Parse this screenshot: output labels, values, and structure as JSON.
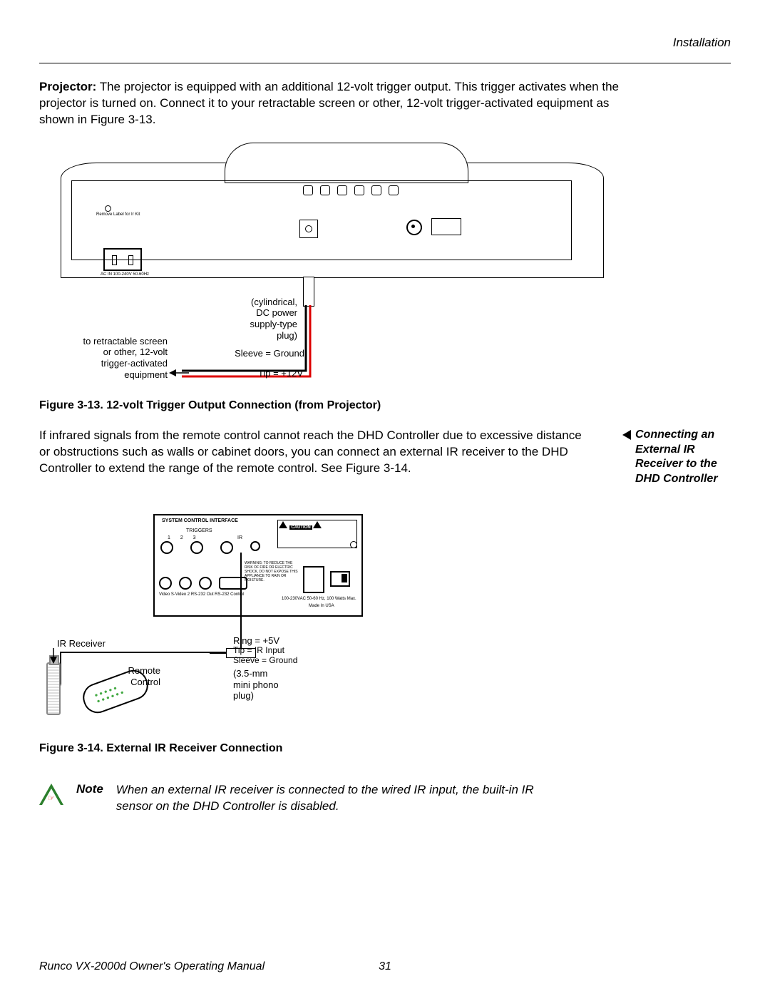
{
  "header": {
    "section": "Installation"
  },
  "para1": {
    "lead": "Projector:",
    "text": " The projector is equipped with an additional 12-volt trigger output. This trigger activates when the projector is turned on. Connect it to your retractable screen or other, 12-volt trigger-activated equipment as shown in Figure 3-13."
  },
  "fig13": {
    "caption": "Figure 3-13. 12-volt Trigger Output Connection (from Projector)",
    "labels": {
      "equip_l1": "to retractable screen",
      "equip_l2": "or other, 12-volt",
      "equip_l3": "trigger-activated",
      "equip_l4": "equipment",
      "plug_l1": "(cylindrical,",
      "plug_l2": "DC power",
      "plug_l3": "supply-type",
      "plug_l4": "plug)",
      "sleeve": "Sleeve = Ground",
      "tip": "Tip = +12V",
      "ac": "AC IN  100-240V  50-60Hz",
      "ir_note": "Remove Label for Ir Kit"
    }
  },
  "para2": "If infrared signals from the remote control cannot reach the DHD Controller due to excessive distance or obstructions such as walls or cabinet doors, you can connect an external IR receiver to the DHD Controller to extend the range of the remote control. See Figure 3-14.",
  "sidehead": "Connecting an External IR Receiver to the DHD Controller",
  "fig14": {
    "caption": "Figure 3-14. External IR Receiver Connection",
    "labels": {
      "sci": "SYSTEM CONTROL INTERFACE",
      "triggers": "TRIGGERS",
      "ir": "IR",
      "nums": "1     2     3",
      "bottom": "Video   S-Video 2   RS-232 Out   RS-232 Control",
      "powerinfo": "100-230VAC 50-60 Hz, 100 Watts Max.",
      "made": "Made In USA",
      "ir_receiver": "IR Receiver",
      "remote_l1": "Remote",
      "remote_l2": "Control",
      "ring": "Ring = +5V",
      "tip": "Tip = IR Input",
      "sleeve": "Sleeve = Ground",
      "plug_l1": "(3.5-mm",
      "plug_l2": "mini phono",
      "plug_l3": "plug)",
      "caution": "CAUTION",
      "warning": "WARNING: TO REDUCE THE RISK OF FIRE OR ELECTRIC SHOCK, DO NOT EXPOSE THIS APPLIANCE TO RAIN OR MOISTURE."
    }
  },
  "note": {
    "label": "Note",
    "text": "When an external IR receiver is connected to the wired IR input, the built-in IR sensor on the DHD Controller is disabled."
  },
  "footer": {
    "left": "Runco VX-2000d Owner's Operating Manual",
    "page": "31"
  }
}
